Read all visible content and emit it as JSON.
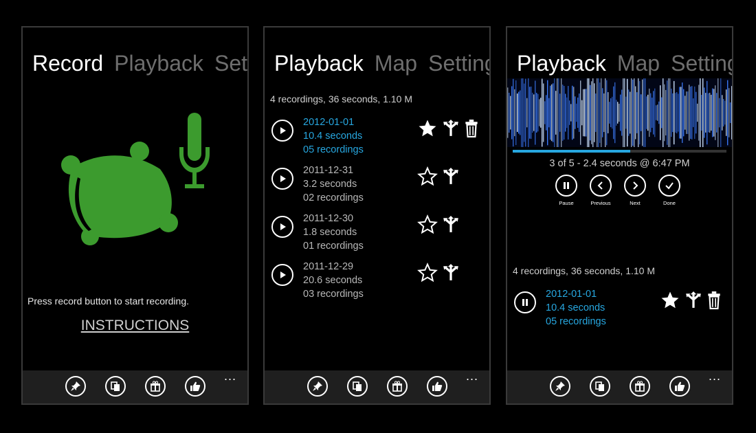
{
  "screens": {
    "record": {
      "pivot": [
        "Record",
        "Playback",
        "Settings"
      ],
      "hint": "Press record button to start recording.",
      "instructions_link": "INSTRUCTIONS",
      "logo_color": "#3c9b2e"
    },
    "playback_list": {
      "pivot": [
        "Playback",
        "Map",
        "Settings"
      ],
      "summary": "4 recordings, 36 seconds,  1.10 M",
      "recordings": [
        {
          "date": "2012-01-01",
          "duration": "10.4 seconds",
          "count": "05 recordings",
          "starred": true,
          "highlighted": true
        },
        {
          "date": "2011-12-31",
          "duration": "3.2 seconds",
          "count": "02 recordings",
          "starred": false,
          "highlighted": false
        },
        {
          "date": "2011-12-30",
          "duration": "1.8 seconds",
          "count": "01 recordings",
          "starred": false,
          "highlighted": false
        },
        {
          "date": "2011-12-29",
          "duration": "20.6 seconds",
          "count": "03 recordings",
          "starred": false,
          "highlighted": false
        }
      ]
    },
    "now_playing": {
      "pivot": [
        "Playback",
        "Map",
        "Settings"
      ],
      "status": "3 of 5 - 2.4 seconds  @ 6:47 PM",
      "progress_percent": 55,
      "controls": [
        {
          "label": "Pause",
          "icon": "pause-icon"
        },
        {
          "label": "Previous",
          "icon": "chevron-left-icon"
        },
        {
          "label": "Next",
          "icon": "chevron-right-icon"
        },
        {
          "label": "Done",
          "icon": "check-icon"
        }
      ],
      "summary": "4 recordings, 36 seconds,  1.10 M",
      "current": {
        "date": "2012-01-01",
        "duration": "10.4 seconds",
        "count": "05 recordings"
      }
    }
  },
  "appbar": {
    "buttons": [
      "pin-icon",
      "copy-icon",
      "gift-icon",
      "thumbs-up-icon"
    ],
    "more": "..."
  },
  "colors": {
    "accent": "#27a7e0",
    "background": "#000000",
    "appbar": "#1f1f1f"
  }
}
